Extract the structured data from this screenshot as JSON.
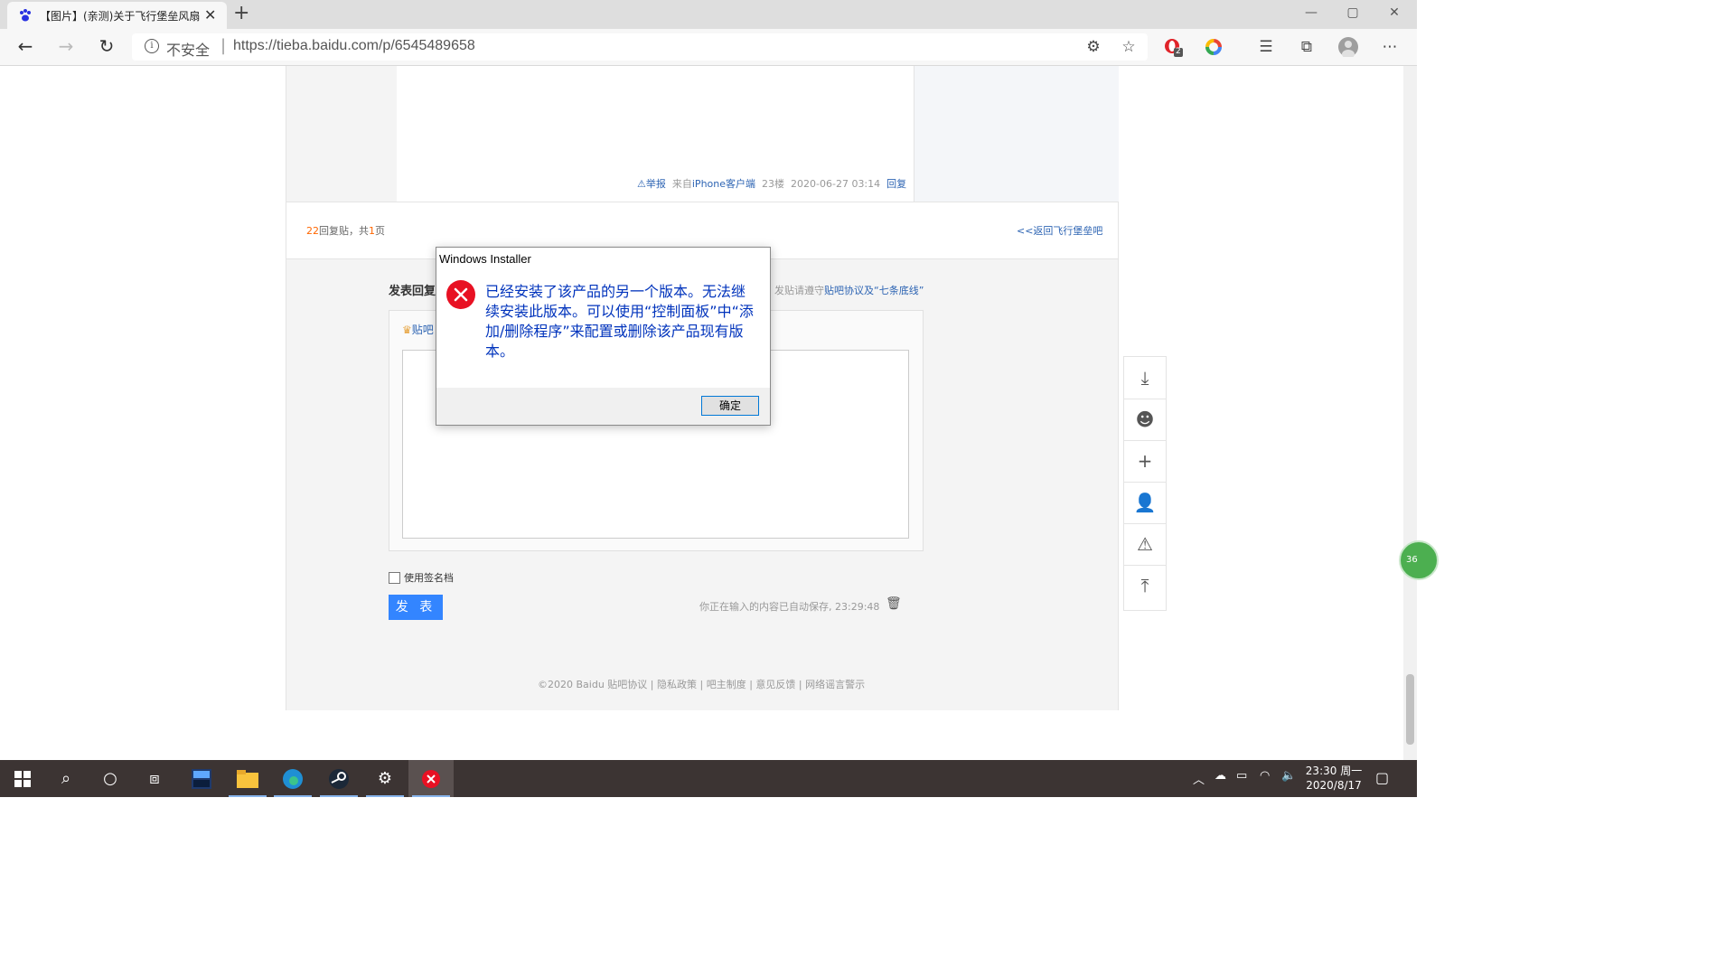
{
  "browser": {
    "tab_title": "【图片】(亲测)关于飞行堡垒风扇",
    "tab_close": "✕",
    "new_tab": "+",
    "security_label": "不安全",
    "url": "https://tieba.baidu.com/p/6545489658",
    "ext_badge_count": "2",
    "window_controls": {
      "minimize": "—",
      "maximize": "▢",
      "close": "✕"
    }
  },
  "post": {
    "report": "举报",
    "source": "来自",
    "client": "iPhone客户端",
    "floor": "23楼",
    "time": "2020-06-27 03:14",
    "reply": "回复"
  },
  "reply_bar": {
    "count": "22",
    "count_suffix": "回复贴，共",
    "pages": "1",
    "pages_suffix": "页",
    "back_link": "<<返回飞行堡垒吧"
  },
  "editor": {
    "title": "发表回复",
    "rule_prefix": "发贴请遵守",
    "rule_link": "贴吧协议及“七条底线”",
    "crown_text": "贴吧",
    "signature_label": "使用签名档",
    "submit": "发 表",
    "autosave": "你正在输入的内容已自动保存, 23:29:48"
  },
  "footer": {
    "copyright": "©2020 Baidu",
    "links": [
      "贴吧协议",
      "隐私政策",
      "吧主制度",
      "意见反馈",
      "网络谣言警示"
    ]
  },
  "floating_badge": "36",
  "dialog": {
    "title": "Windows Installer",
    "message": "已经安装了该产品的另一个版本。无法继续安装此版本。可以使用“控制面板”中“添加/删除程序”来配置或删除该产品现有版本。",
    "ok": "确定"
  },
  "taskbar": {
    "apps": [
      "start-icon",
      "search-icon",
      "cortana-icon",
      "task-view-icon",
      "dev-app-icon",
      "file-explorer-icon",
      "edge-icon",
      "steam-icon",
      "settings-icon",
      "error-app-icon"
    ],
    "clock_time": "23:30 周一",
    "clock_date": "2020/8/17"
  },
  "colors": {
    "accent_blue": "#3385ff",
    "link_blue": "#2d64b3",
    "error_red": "#e81123",
    "dialog_text": "#0033bc",
    "taskbar": "#3c3433"
  }
}
